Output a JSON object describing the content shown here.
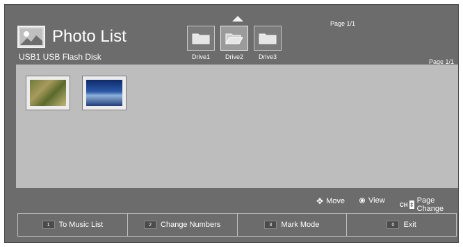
{
  "header": {
    "title": "Photo List",
    "title_icon": "photo-icon",
    "device": "USB1 USB Flash Disk",
    "page_top": "Page 1/1",
    "page_right": "Page 1/1"
  },
  "drives": [
    {
      "label": "Drive1",
      "icon": "folder-icon",
      "selected": false
    },
    {
      "label": "Drive2",
      "icon": "open-folder-icon",
      "selected": true
    },
    {
      "label": "Drive3",
      "icon": "folder-icon",
      "selected": false
    }
  ],
  "thumbnails": [
    {
      "name": "photo-1"
    },
    {
      "name": "photo-2"
    }
  ],
  "legend": {
    "move": "Move",
    "view": "View",
    "ch_label": "CH",
    "page_change": "Page Change"
  },
  "bottom": [
    {
      "num": "1",
      "label": "To Music List"
    },
    {
      "num": "2",
      "label": "Change Numbers"
    },
    {
      "num": "3",
      "label": "Mark Mode"
    },
    {
      "num": "0",
      "label": "Exit"
    }
  ]
}
